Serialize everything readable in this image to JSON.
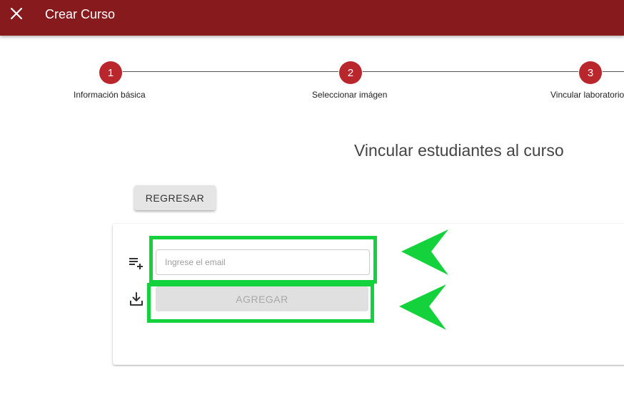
{
  "appbar": {
    "title": "Crear Curso",
    "close_icon": "close-icon",
    "background": "#861a1c"
  },
  "stepper": {
    "steps": [
      {
        "number": "1",
        "label": "Información básica"
      },
      {
        "number": "2",
        "label": "Seleccionar imágen"
      },
      {
        "number": "3",
        "label": "Vincular laboratorio"
      }
    ],
    "accent": "#b9262b"
  },
  "main": {
    "title": "Vincular estudiantes al curso",
    "back_label": "REGRESAR"
  },
  "card": {
    "email_placeholder": "Ingrese el email",
    "email_value": "",
    "add_label": "AGREGAR",
    "list_add_icon": "playlist-add-icon",
    "download_icon": "download-icon"
  },
  "annotations": {
    "color": "#14d23c"
  }
}
